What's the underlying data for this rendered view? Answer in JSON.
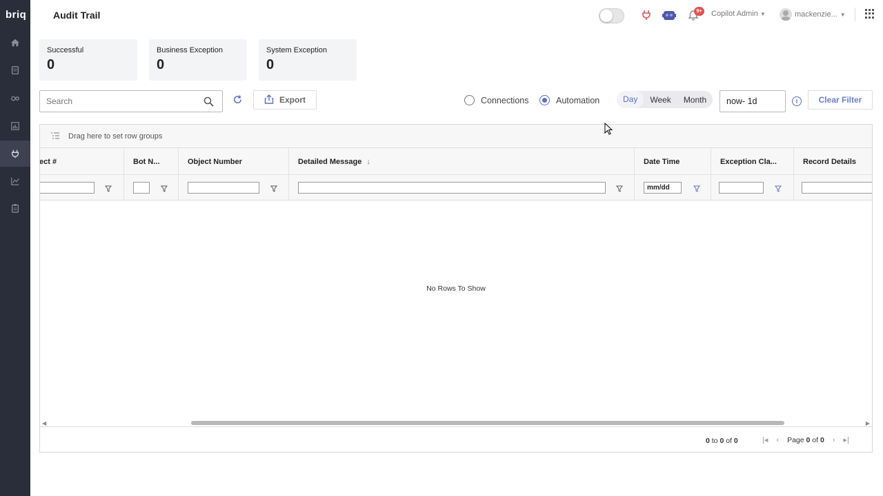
{
  "app": {
    "logo": "briq",
    "page_title": "Audit Trail"
  },
  "sidebar": {
    "items": [
      {
        "name": "home-icon"
      },
      {
        "name": "document-icon"
      },
      {
        "name": "cogs-icon"
      },
      {
        "name": "bar-chart-icon"
      },
      {
        "name": "plug-icon",
        "active": true
      },
      {
        "name": "line-chart-icon"
      },
      {
        "name": "clipboard-icon"
      }
    ]
  },
  "topbar": {
    "notification_badge": "9+",
    "role": "Copilot Admin",
    "username": "mackenzie..."
  },
  "summary": {
    "cards": [
      {
        "label": "Successful",
        "value": "0"
      },
      {
        "label": "Business Exception",
        "value": "0"
      },
      {
        "label": "System Exception",
        "value": "0"
      }
    ]
  },
  "toolbar": {
    "search_placeholder": "Search",
    "export_label": "Export",
    "radio_connections": "Connections",
    "radio_automation": "Automation",
    "selected_radio": "Automation",
    "period_day": "Day",
    "period_week": "Week",
    "period_month": "Month",
    "selected_period": "Day",
    "relative_time": "now- 1d",
    "clear_filter": "Clear Filter"
  },
  "grid": {
    "group_hint": "Drag here to set row groups",
    "columns": [
      {
        "title": "ect #"
      },
      {
        "title": "Bot N..."
      },
      {
        "title": "Object Number"
      },
      {
        "title": "Detailed Message",
        "sorted": "desc"
      },
      {
        "title": "Date Time",
        "filter_placeholder": "mm/dd"
      },
      {
        "title": "Exception Cla..."
      },
      {
        "title": "Record Details"
      }
    ],
    "empty_message": "No Rows To Show",
    "pagination": {
      "range_from": "0",
      "range_to": "0",
      "total": "0",
      "rows_to": "to",
      "rows_of": "of",
      "page_label": "Page",
      "page_current": "0",
      "page_of": "of",
      "page_total": "0"
    }
  },
  "colors": {
    "accent": "#5b6fc8",
    "sidebar_bg": "#2a2d3a",
    "badge": "#e05454"
  }
}
